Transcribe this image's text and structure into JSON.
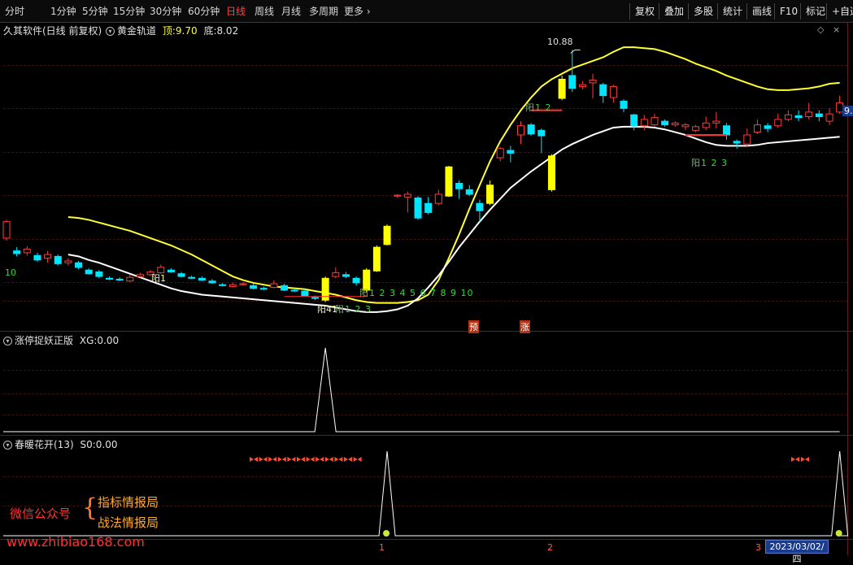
{
  "toolbar": {
    "periods": [
      "分时",
      "1分钟",
      "5分钟",
      "15分钟",
      "30分钟",
      "60分钟",
      "日线",
      "周线",
      "月线",
      "多周期",
      "更多"
    ],
    "active_period": "日线",
    "tools": [
      "复权",
      "叠加",
      "多股",
      "统计",
      "画线",
      "F10",
      "标记",
      "+自选"
    ]
  },
  "main_header": {
    "app_name": "久其软件(日线 前复权)",
    "indicator": "黄金轨道",
    "top_label": "顶:",
    "top_value": "9.70",
    "bottom_label": "底:",
    "bottom_value": "8.02"
  },
  "main_annotations": {
    "peak_value": "10.88",
    "left_price": "10",
    "right_price_partial": "9.",
    "low_left_label": "阳41",
    "count_labels_1": "阳1 2 3 4 5 6 7 8 9 10",
    "count_labels_2": "阳1 2 3",
    "count_labels_3": "阳1 2",
    "count_labels_4": "阳1 2 3",
    "count_labels_5": "阳1",
    "tag_yu": "预",
    "tag_zhang": "涨"
  },
  "panel2": {
    "name": "涨停捉妖正版",
    "var": "XG:",
    "value": "0.00"
  },
  "panel3": {
    "name": "春暖花开(13)",
    "var": "S0:",
    "value": "0.00"
  },
  "watermark": {
    "line_label": "微信公众号",
    "item1": "指标情报局",
    "item2": "战法情报局",
    "url": "www.zhibiao168.com"
  },
  "time_axis": {
    "marks": [
      "1",
      "2",
      "3"
    ],
    "current_date": "2023/03/02/四"
  },
  "colors": {
    "up": "#ff3b3b",
    "down": "#00e5ff",
    "yellow": "#ffff00",
    "upper_band": "#ffff33",
    "lower_band": "#ffffff",
    "active_tab": "#ff4444"
  },
  "chart_data": {
    "type": "candlestick",
    "bands": {
      "upper": [
        9.05,
        9.04,
        9.02,
        8.99,
        8.96,
        8.93,
        8.9,
        8.86,
        8.82,
        8.78,
        8.74,
        8.69,
        8.64,
        8.58,
        8.52,
        8.46,
        8.4,
        8.36,
        8.33,
        8.31,
        8.29,
        8.28,
        8.27,
        8.26,
        8.24,
        8.22,
        8.2,
        8.17,
        8.14,
        8.12,
        8.11,
        8.11,
        8.11,
        8.12,
        8.14,
        8.2,
        8.36,
        8.6,
        8.86,
        9.14,
        9.4,
        9.66,
        9.88,
        10.06,
        10.22,
        10.36,
        10.48,
        10.56,
        10.62,
        10.68,
        10.72,
        10.76,
        10.8,
        10.86,
        10.91,
        10.91,
        10.9,
        10.89,
        10.86,
        10.82,
        10.78,
        10.73,
        10.69,
        10.65,
        10.6,
        10.56,
        10.52,
        10.48,
        10.45,
        10.44,
        10.44,
        10.45,
        10.46,
        10.48,
        10.51,
        10.52
      ],
      "lower": [
        8.64,
        8.62,
        8.58,
        8.55,
        8.51,
        8.47,
        8.43,
        8.39,
        8.35,
        8.31,
        8.27,
        8.24,
        8.22,
        8.2,
        8.19,
        8.18,
        8.17,
        8.16,
        8.15,
        8.14,
        8.13,
        8.12,
        8.11,
        8.1,
        8.09,
        8.08,
        8.06,
        8.04,
        8.02,
        8.01,
        8.01,
        8.02,
        8.04,
        8.08,
        8.16,
        8.28,
        8.41,
        8.56,
        8.72,
        8.86,
        9.0,
        9.13,
        9.25,
        9.37,
        9.46,
        9.55,
        9.63,
        9.71,
        9.79,
        9.85,
        9.9,
        9.95,
        9.99,
        10.03,
        10.04,
        10.04,
        10.04,
        10.03,
        10.01,
        9.98,
        9.95,
        9.91,
        9.87,
        9.84,
        9.83,
        9.83,
        9.83,
        9.84,
        9.86,
        9.87,
        9.88,
        9.89,
        9.9,
        9.91,
        9.92,
        9.93
      ],
      "label_top": "9.70",
      "label_bottom": "8.02"
    },
    "candles": [
      {
        "o": 8.82,
        "c": 9.0,
        "h": 9.02,
        "l": 8.79
      },
      {
        "o": 8.68,
        "c": 8.65,
        "h": 8.72,
        "l": 8.62
      },
      {
        "o": 8.66,
        "c": 8.7,
        "h": 8.73,
        "l": 8.63
      },
      {
        "o": 8.63,
        "c": 8.58,
        "h": 8.66,
        "l": 8.56
      },
      {
        "o": 8.6,
        "c": 8.64,
        "h": 8.68,
        "l": 8.55
      },
      {
        "o": 8.62,
        "c": 8.54,
        "h": 8.64,
        "l": 8.52
      },
      {
        "o": 8.55,
        "c": 8.57,
        "h": 8.6,
        "l": 8.52
      },
      {
        "o": 8.55,
        "c": 8.5,
        "h": 8.57,
        "l": 8.48
      },
      {
        "o": 8.47,
        "c": 8.43,
        "h": 8.49,
        "l": 8.42
      },
      {
        "o": 8.45,
        "c": 8.4,
        "h": 8.47,
        "l": 8.38
      },
      {
        "o": 8.38,
        "c": 8.37,
        "h": 8.4,
        "l": 8.36
      },
      {
        "o": 8.37,
        "c": 8.36,
        "h": 8.39,
        "l": 8.35
      },
      {
        "o": 8.35,
        "c": 8.39,
        "h": 8.42,
        "l": 8.34
      },
      {
        "o": 8.4,
        "c": 8.42,
        "h": 8.44,
        "l": 8.39
      },
      {
        "o": 8.42,
        "c": 8.45,
        "h": 8.47,
        "l": 8.41
      },
      {
        "o": 8.44,
        "c": 8.5,
        "h": 8.53,
        "l": 8.43
      },
      {
        "o": 8.47,
        "c": 8.45,
        "h": 8.49,
        "l": 8.44
      },
      {
        "o": 8.43,
        "c": 8.4,
        "h": 8.45,
        "l": 8.39
      },
      {
        "o": 8.39,
        "c": 8.38,
        "h": 8.41,
        "l": 8.37
      },
      {
        "o": 8.38,
        "c": 8.36,
        "h": 8.4,
        "l": 8.35
      },
      {
        "o": 8.35,
        "c": 8.33,
        "h": 8.37,
        "l": 8.32
      },
      {
        "o": 8.31,
        "c": 8.3,
        "h": 8.33,
        "l": 8.29
      },
      {
        "o": 8.29,
        "c": 8.31,
        "h": 8.33,
        "l": 8.28
      },
      {
        "o": 8.31,
        "c": 8.32,
        "h": 8.34,
        "l": 8.3
      },
      {
        "o": 8.3,
        "c": 8.27,
        "h": 8.32,
        "l": 8.26
      },
      {
        "o": 8.27,
        "c": 8.26,
        "h": 8.29,
        "l": 8.25
      },
      {
        "o": 8.28,
        "c": 8.32,
        "h": 8.36,
        "l": 8.27
      },
      {
        "o": 8.3,
        "c": 8.25,
        "h": 8.32,
        "l": 8.24
      },
      {
        "o": 8.25,
        "c": 8.24,
        "h": 8.27,
        "l": 8.23
      },
      {
        "o": 8.24,
        "c": 8.19,
        "h": 8.26,
        "l": 8.18
      },
      {
        "o": 8.17,
        "c": 8.16,
        "h": 8.19,
        "l": 8.14
      },
      {
        "o": 8.14,
        "c": 8.38,
        "h": 8.4,
        "l": 8.12,
        "yellow": true
      },
      {
        "o": 8.4,
        "c": 8.44,
        "h": 8.5,
        "l": 8.38
      },
      {
        "o": 8.42,
        "c": 8.4,
        "h": 8.45,
        "l": 8.38
      },
      {
        "o": 8.38,
        "c": 8.33,
        "h": 8.4,
        "l": 8.3
      },
      {
        "o": 8.25,
        "c": 8.47,
        "h": 8.49,
        "l": 8.23,
        "yellow": true
      },
      {
        "o": 8.46,
        "c": 8.72,
        "h": 8.74,
        "l": 8.45,
        "yellow": true
      },
      {
        "o": 8.75,
        "c": 8.95,
        "h": 8.97,
        "l": 8.74,
        "yellow": true
      },
      {
        "o": 9.28,
        "c": 9.29,
        "h": 9.3,
        "l": 9.26
      },
      {
        "o": 9.27,
        "c": 9.3,
        "h": 9.33,
        "l": 9.1
      },
      {
        "o": 9.26,
        "c": 9.04,
        "h": 9.28,
        "l": 9.02
      },
      {
        "o": 9.2,
        "c": 9.1,
        "h": 9.27,
        "l": 9.08
      },
      {
        "o": 9.2,
        "c": 9.3,
        "h": 9.35,
        "l": 9.18
      },
      {
        "o": 9.6,
        "c": 9.28,
        "h": 9.61,
        "l": 9.27,
        "yellow": true
      },
      {
        "o": 9.42,
        "c": 9.36,
        "h": 9.45,
        "l": 9.25
      },
      {
        "o": 9.35,
        "c": 9.3,
        "h": 9.4,
        "l": 9.28
      },
      {
        "o": 9.2,
        "c": 9.12,
        "h": 9.24,
        "l": 9.0
      },
      {
        "o": 9.4,
        "c": 9.2,
        "h": 9.45,
        "l": 9.18,
        "yellow": true
      },
      {
        "o": 9.7,
        "c": 9.8,
        "h": 9.82,
        "l": 9.66
      },
      {
        "o": 9.78,
        "c": 9.75,
        "h": 9.83,
        "l": 9.65
      },
      {
        "o": 9.95,
        "c": 10.05,
        "h": 10.1,
        "l": 9.85
      },
      {
        "o": 10.06,
        "c": 9.96,
        "h": 10.08,
        "l": 9.94
      },
      {
        "o": 10.0,
        "c": 9.94,
        "h": 10.02,
        "l": 9.75
      },
      {
        "o": 9.72,
        "c": 9.35,
        "h": 9.74,
        "l": 9.33,
        "yellow": true
      },
      {
        "o": 10.35,
        "c": 10.56,
        "h": 10.6,
        "l": 10.33,
        "yellow": true
      },
      {
        "o": 10.6,
        "c": 10.46,
        "h": 10.88,
        "l": 10.42
      },
      {
        "o": 10.48,
        "c": 10.5,
        "h": 10.54,
        "l": 10.45
      },
      {
        "o": 10.52,
        "c": 10.55,
        "h": 10.62,
        "l": 10.35
      },
      {
        "o": 10.5,
        "c": 10.38,
        "h": 10.52,
        "l": 10.3
      },
      {
        "o": 10.36,
        "c": 10.48,
        "h": 10.5,
        "l": 10.3
      },
      {
        "o": 10.32,
        "c": 10.24,
        "h": 10.34,
        "l": 10.2
      },
      {
        "o": 10.17,
        "c": 10.05,
        "h": 10.18,
        "l": 10.0
      },
      {
        "o": 10.05,
        "c": 10.12,
        "h": 10.17,
        "l": 10.0
      },
      {
        "o": 10.06,
        "c": 10.14,
        "h": 10.18,
        "l": 10.04
      },
      {
        "o": 10.1,
        "c": 10.06,
        "h": 10.12,
        "l": 10.04
      },
      {
        "o": 10.06,
        "c": 10.08,
        "h": 10.1,
        "l": 10.04
      },
      {
        "o": 10.04,
        "c": 10.06,
        "h": 10.08,
        "l": 10.0
      },
      {
        "o": 10.0,
        "c": 10.04,
        "h": 10.06,
        "l": 9.98
      },
      {
        "o": 10.03,
        "c": 10.08,
        "h": 10.15,
        "l": 10.0
      },
      {
        "o": 10.08,
        "c": 10.1,
        "h": 10.2,
        "l": 10.02
      },
      {
        "o": 10.05,
        "c": 9.95,
        "h": 10.08,
        "l": 9.9
      },
      {
        "o": 9.88,
        "c": 9.86,
        "h": 9.9,
        "l": 9.8
      },
      {
        "o": 9.85,
        "c": 9.95,
        "h": 10.02,
        "l": 9.82
      },
      {
        "o": 9.98,
        "c": 10.06,
        "h": 10.12,
        "l": 9.96
      },
      {
        "o": 10.05,
        "c": 10.02,
        "h": 10.08,
        "l": 9.98
      },
      {
        "o": 10.05,
        "c": 10.12,
        "h": 10.18,
        "l": 10.03
      },
      {
        "o": 10.12,
        "c": 10.17,
        "h": 10.22,
        "l": 10.1
      },
      {
        "o": 10.16,
        "c": 10.14,
        "h": 10.22,
        "l": 10.1
      },
      {
        "o": 10.15,
        "c": 10.2,
        "h": 10.3,
        "l": 10.12
      },
      {
        "o": 10.18,
        "c": 10.15,
        "h": 10.22,
        "l": 10.1
      },
      {
        "o": 10.1,
        "c": 10.18,
        "h": 10.24,
        "l": 10.06
      },
      {
        "o": 10.2,
        "c": 10.3,
        "h": 10.38,
        "l": 10.18
      }
    ],
    "xg_signal": [
      0,
      0,
      0,
      0,
      0,
      0,
      0,
      0,
      0,
      0,
      0,
      0,
      0,
      0,
      0,
      0,
      0,
      0,
      0,
      0,
      0,
      0,
      0,
      0,
      0,
      0,
      0,
      0,
      0,
      0,
      0,
      1,
      0,
      0,
      0,
      0,
      0,
      0,
      0,
      0,
      0,
      0,
      0,
      0,
      0,
      0,
      0,
      0,
      0,
      0,
      0,
      0,
      0,
      0,
      0,
      0,
      0,
      0,
      0,
      0,
      0,
      0,
      0,
      0,
      0,
      0,
      0,
      0,
      0,
      0,
      0,
      0,
      0,
      0,
      0,
      0,
      0,
      0,
      0,
      0,
      0,
      0
    ],
    "s0_signal": [
      0,
      0,
      0,
      0,
      0,
      0,
      0,
      0,
      0,
      0,
      0,
      0,
      0,
      0,
      0,
      0,
      0,
      0,
      0,
      0,
      0,
      0,
      0,
      0,
      0,
      0,
      0,
      0,
      0,
      0,
      0,
      0,
      0,
      0,
      0,
      0,
      0,
      1,
      0,
      0,
      0,
      0,
      0,
      0,
      0,
      0,
      0,
      0,
      0,
      0,
      0,
      0,
      0,
      0,
      0,
      0,
      0,
      0,
      0,
      0,
      0,
      0,
      0,
      0,
      0,
      0,
      0,
      0,
      0,
      0,
      0,
      0,
      0,
      0,
      0,
      0,
      0,
      0,
      0,
      0,
      0,
      1
    ],
    "ylim": [
      8.0,
      11.0
    ]
  }
}
